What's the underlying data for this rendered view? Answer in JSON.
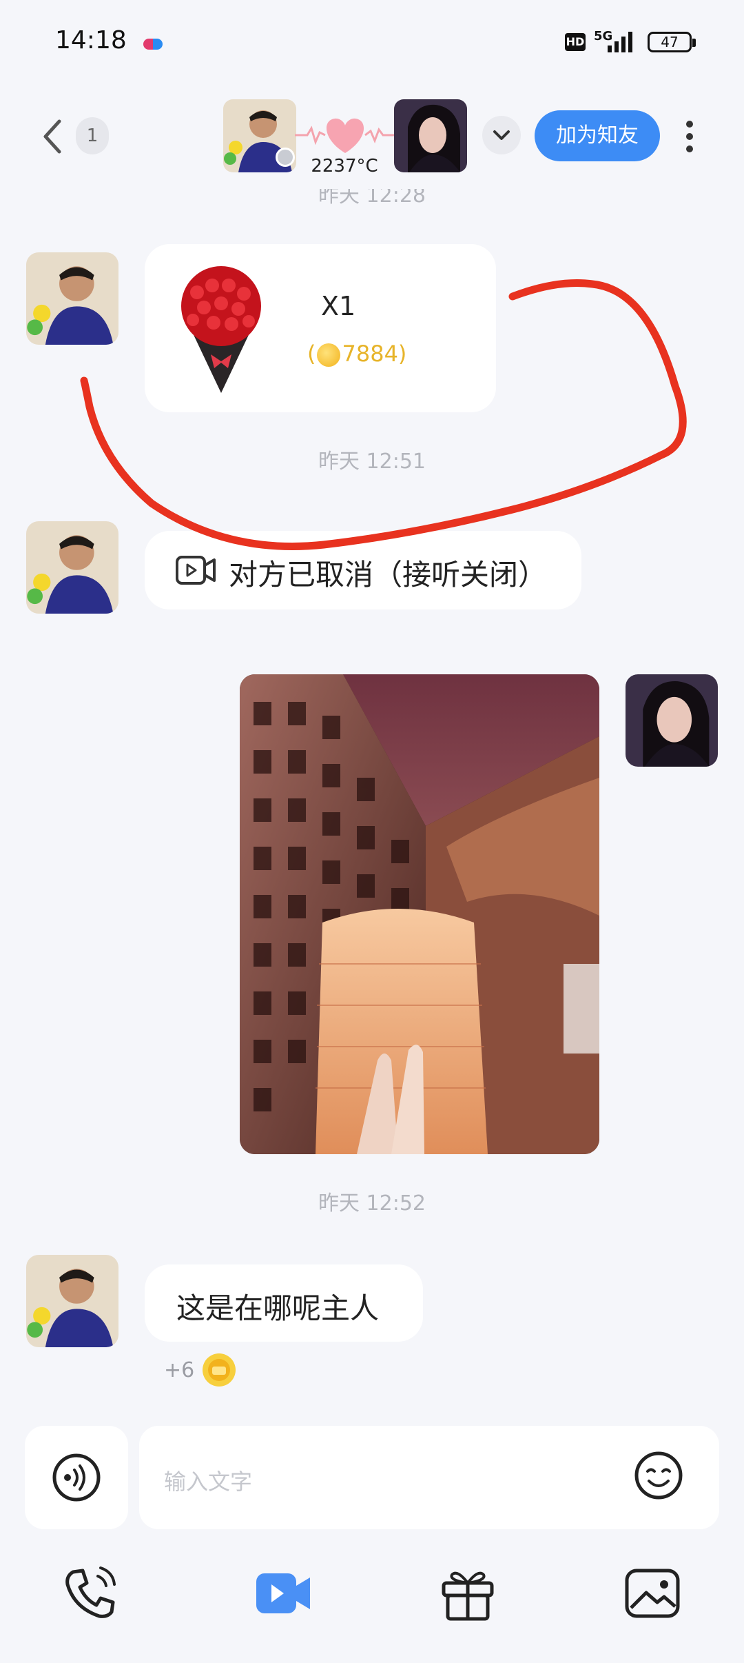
{
  "status_bar": {
    "time": "14:18",
    "hd": "HD",
    "network": "5G",
    "battery": "47"
  },
  "header": {
    "unread_count": "1",
    "temperature": "2237°C",
    "add_friend_label": "加为知友"
  },
  "messages": {
    "top_time_partial": "昨天 12:28",
    "gift": {
      "count": "X1",
      "coins": "7884"
    },
    "time_1": "昨天 12:51",
    "call_status": "对方已取消（接听关闭）",
    "time_2": "昨天 12:52",
    "text_message": "这是在哪呢主人",
    "reward": "+6"
  },
  "input": {
    "placeholder": "输入文字"
  },
  "colors": {
    "accent": "#3d8cf5",
    "coin": "#e7b42a",
    "annotation": "#e8321f"
  }
}
